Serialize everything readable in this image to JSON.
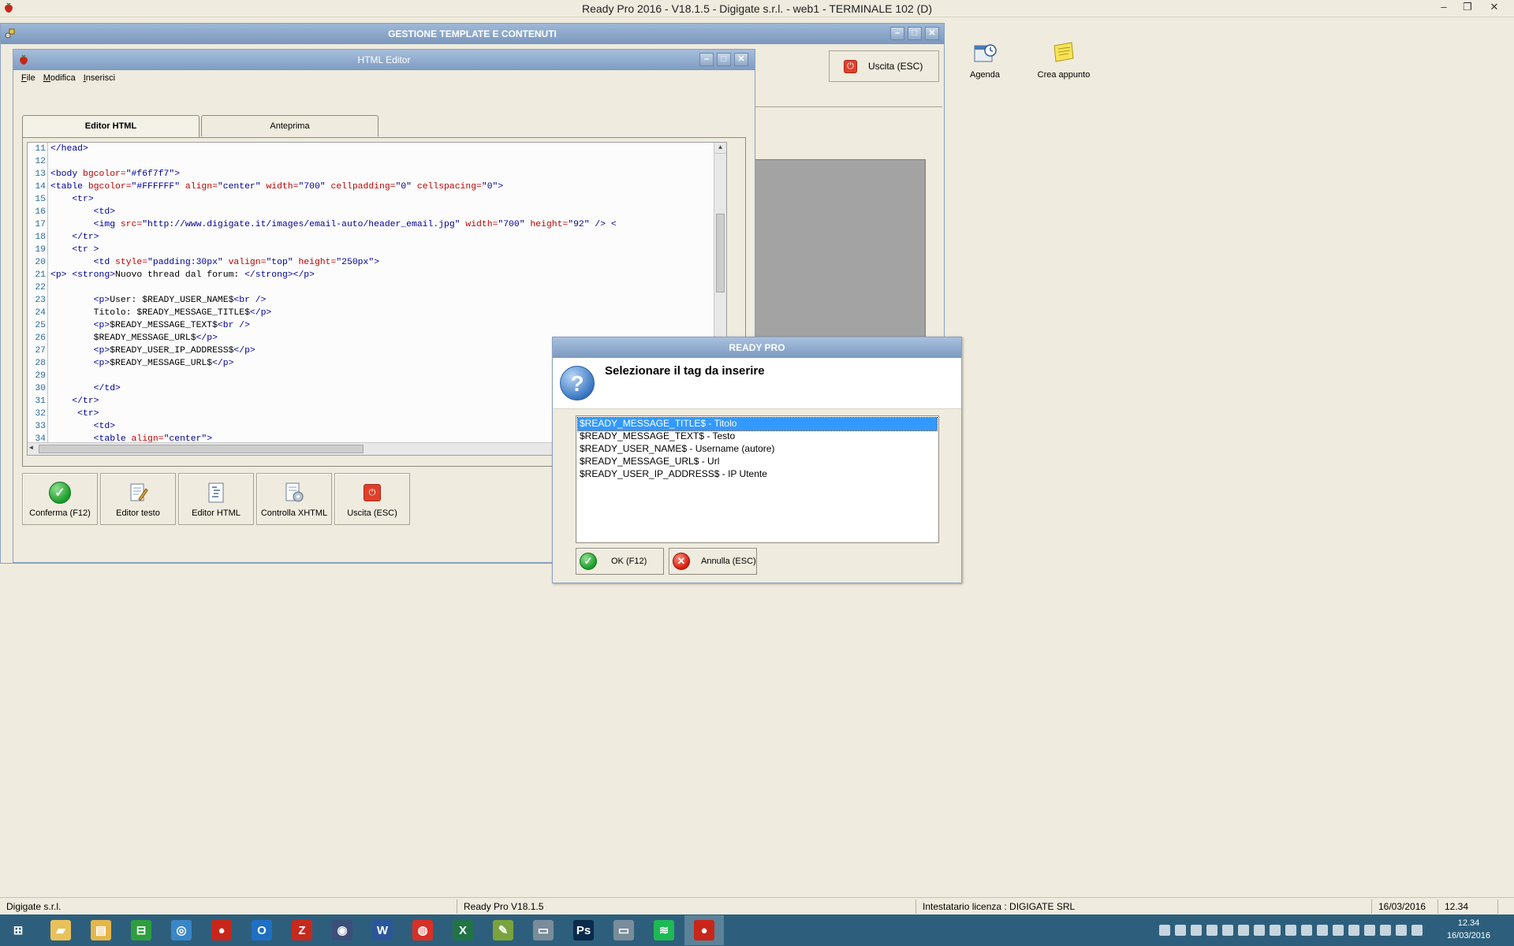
{
  "app": {
    "title": "Ready Pro 2016 - V18.1.5 - Digigate s.r.l. - web1 - TERMINALE 102 (D)",
    "minimize": "–",
    "restore": "❐",
    "close": "✕"
  },
  "module": {
    "title": "GESTIONE TEMPLATE E CONTENUTI",
    "exit_label": "Uscita (ESC)"
  },
  "desktop": {
    "agenda_label": "Agenda",
    "crea_appuntamento_label": "Crea appunto"
  },
  "editor": {
    "title": "HTML Editor",
    "menu": [
      "File",
      "Modifica",
      "Inserisci"
    ],
    "tabs": [
      "Editor HTML",
      "Anteprima"
    ],
    "code_lines": [
      {
        "n": "11",
        "parts": [
          [
            "t",
            "</head>"
          ]
        ]
      },
      {
        "n": "12",
        "parts": []
      },
      {
        "n": "13",
        "parts": [
          [
            "t",
            "<body "
          ],
          [
            "a",
            "bgcolor="
          ],
          [
            "v",
            "\"#f6f7f7\""
          ],
          [
            "t",
            ">"
          ]
        ]
      },
      {
        "n": "14",
        "parts": [
          [
            "t",
            "<table "
          ],
          [
            "a",
            "bgcolor="
          ],
          [
            "v",
            "\"#FFFFFF\" "
          ],
          [
            "a",
            "align="
          ],
          [
            "v",
            "\"center\" "
          ],
          [
            "a",
            "width="
          ],
          [
            "v",
            "\"700\" "
          ],
          [
            "a",
            "cellpadding="
          ],
          [
            "v",
            "\"0\" "
          ],
          [
            "a",
            "cellspacing="
          ],
          [
            "v",
            "\"0\""
          ],
          [
            "t",
            ">"
          ]
        ]
      },
      {
        "n": "15",
        "parts": [
          [
            "t",
            "    <tr>"
          ]
        ]
      },
      {
        "n": "16",
        "parts": [
          [
            "t",
            "        <td>"
          ]
        ]
      },
      {
        "n": "17",
        "parts": [
          [
            "t",
            "        <img "
          ],
          [
            "a",
            "src="
          ],
          [
            "v",
            "\"http://www.digigate.it/images/email-auto/header_email.jpg\" "
          ],
          [
            "a",
            "width="
          ],
          [
            "v",
            "\"700\" "
          ],
          [
            "a",
            "height="
          ],
          [
            "v",
            "\"92\""
          ],
          [
            "t",
            " /> <"
          ]
        ]
      },
      {
        "n": "18",
        "parts": [
          [
            "t",
            "    </tr>"
          ]
        ]
      },
      {
        "n": "19",
        "parts": [
          [
            "t",
            "    <tr >"
          ]
        ]
      },
      {
        "n": "20",
        "parts": [
          [
            "t",
            "        <td "
          ],
          [
            "a",
            "style="
          ],
          [
            "v",
            "\"padding:30px\" "
          ],
          [
            "a",
            "valign="
          ],
          [
            "v",
            "\"top\" "
          ],
          [
            "a",
            "height="
          ],
          [
            "v",
            "\"250px\""
          ],
          [
            "t",
            ">"
          ]
        ]
      },
      {
        "n": "21",
        "parts": [
          [
            "t",
            "<p> <strong>"
          ],
          [
            "x",
            "Nuovo thread dal forum: "
          ],
          [
            "t",
            "</strong></p>"
          ]
        ]
      },
      {
        "n": "22",
        "parts": []
      },
      {
        "n": "23",
        "parts": [
          [
            "t",
            "        <p>"
          ],
          [
            "x",
            "User: $READY_USER_NAME$"
          ],
          [
            "t",
            "<br />"
          ]
        ]
      },
      {
        "n": "24",
        "parts": [
          [
            "x",
            "        Titolo: $READY_MESSAGE_TITLE$"
          ],
          [
            "t",
            "</p>"
          ]
        ]
      },
      {
        "n": "25",
        "parts": [
          [
            "t",
            "        <p>"
          ],
          [
            "x",
            "$READY_MESSAGE_TEXT$"
          ],
          [
            "t",
            "<br />"
          ]
        ]
      },
      {
        "n": "26",
        "parts": [
          [
            "x",
            "        $READY_MESSAGE_URL$"
          ],
          [
            "t",
            "</p>"
          ]
        ]
      },
      {
        "n": "27",
        "parts": [
          [
            "t",
            "        <p>"
          ],
          [
            "x",
            "$READY_USER_IP_ADDRESS$"
          ],
          [
            "t",
            "</p>"
          ]
        ]
      },
      {
        "n": "28",
        "parts": [
          [
            "t",
            "        <p>"
          ],
          [
            "x",
            "$READY_MESSAGE_URL$"
          ],
          [
            "t",
            "</p>"
          ]
        ]
      },
      {
        "n": "29",
        "parts": []
      },
      {
        "n": "30",
        "parts": [
          [
            "t",
            "        </td>"
          ]
        ]
      },
      {
        "n": "31",
        "parts": [
          [
            "t",
            "    </tr>"
          ]
        ]
      },
      {
        "n": "32",
        "parts": [
          [
            "t",
            "     <tr>"
          ]
        ]
      },
      {
        "n": "33",
        "parts": [
          [
            "t",
            "        <td>"
          ]
        ]
      },
      {
        "n": "34",
        "parts": [
          [
            "t",
            "        <table "
          ],
          [
            "a",
            "align="
          ],
          [
            "v",
            "\"center\""
          ],
          [
            "t",
            ">"
          ]
        ]
      }
    ],
    "toolbar": {
      "confirm": "Conferma (F12)",
      "text_editor": "Editor testo",
      "html_editor": "Editor HTML",
      "check_xhtml": "Controlla XHTML",
      "exit": "Uscita (ESC)"
    }
  },
  "dialog": {
    "title": "READY PRO",
    "message": "Selezionare il tag da inserire",
    "items": [
      "$READY_MESSAGE_TITLE$ - Titolo",
      "$READY_MESSAGE_TEXT$ - Testo",
      "$READY_USER_NAME$ - Username (autore)",
      "$READY_MESSAGE_URL$ - Url",
      "$READY_USER_IP_ADDRESS$ - IP Utente"
    ],
    "selected_index": 0,
    "ok_label": "OK (F12)",
    "cancel_label": "Annulla (ESC)"
  },
  "statusbar": {
    "company": "Digigate s.r.l.",
    "version": "Ready Pro V18.1.5",
    "license": "Intestatario licenza : DIGIGATE SRL",
    "date": "16/03/2016",
    "time": "12.34"
  },
  "taskbar": {
    "clock_time": "12.34",
    "clock_date": "16/03/2016",
    "apps": [
      {
        "name": "start",
        "glyph": "⊞",
        "color": "#2d5f7c"
      },
      {
        "name": "explorer-shell",
        "glyph": "▰",
        "color": "#e8c15a"
      },
      {
        "name": "file-explorer",
        "glyph": "▤",
        "color": "#e5b64a"
      },
      {
        "name": "store",
        "glyph": "⊟",
        "color": "#2e9e3e"
      },
      {
        "name": "chrome-dev",
        "glyph": "◎",
        "color": "#3a86c8"
      },
      {
        "name": "ready-pro-red",
        "glyph": "●",
        "color": "#c8261b"
      },
      {
        "name": "outlook",
        "glyph": "O",
        "color": "#1f6fc4"
      },
      {
        "name": "filezilla",
        "glyph": "Z",
        "color": "#c62a1e"
      },
      {
        "name": "keepass",
        "glyph": "◉",
        "color": "#3b4f7a"
      },
      {
        "name": "word",
        "glyph": "W",
        "color": "#2b579a"
      },
      {
        "name": "chrome",
        "glyph": "◍",
        "color": "#d93025"
      },
      {
        "name": "excel",
        "glyph": "X",
        "color": "#217346"
      },
      {
        "name": "notepadpp",
        "glyph": "✎",
        "color": "#7aa33d"
      },
      {
        "name": "window-a",
        "glyph": "▭",
        "color": "#7a8c9a"
      },
      {
        "name": "photoshop",
        "glyph": "Ps",
        "color": "#0c2a4a"
      },
      {
        "name": "window-b",
        "glyph": "▭",
        "color": "#7a8c9a"
      },
      {
        "name": "spotify",
        "glyph": "≋",
        "color": "#1db954"
      },
      {
        "name": "ready-pro",
        "glyph": "●",
        "color": "#c8261b"
      }
    ]
  }
}
